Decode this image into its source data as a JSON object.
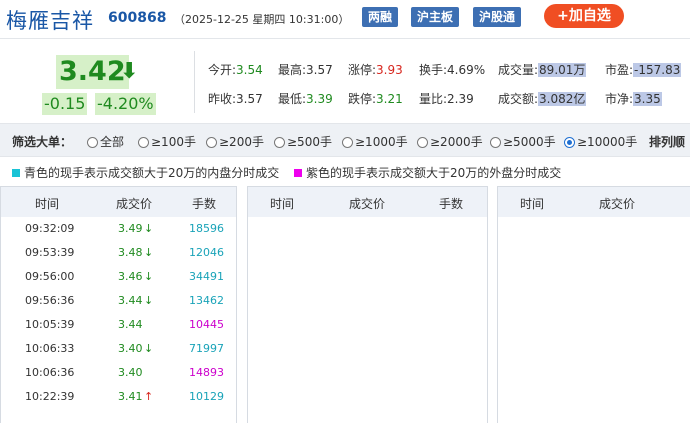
{
  "header": {
    "name": "梅雁吉祥",
    "code": "600868",
    "datetime": "（2025-12-25 星期四 10:31:00）",
    "tags": [
      "两融",
      "沪主板",
      "沪股通"
    ],
    "add_button": "+加自选"
  },
  "quote": {
    "price": "3.42",
    "price_arrow": "⬇",
    "change": "-0.15",
    "change_pct": "-4.20%",
    "stats": {
      "open_label": "今开:",
      "open": "3.54",
      "high_label": "最高:",
      "high": "3.57",
      "limit_up_label": "涨停:",
      "limit_up": "3.93",
      "turnover_label": "换手:",
      "turnover": "4.69%",
      "volume_label": "成交量:",
      "volume": "89.01万",
      "pe_label": "市盈:",
      "pe": "-157.83",
      "prev_close_label": "昨收:",
      "prev_close": "3.57",
      "low_label": "最低:",
      "low": "3.39",
      "limit_down_label": "跌停:",
      "limit_down": "3.21",
      "vol_ratio_label": "量比:",
      "vol_ratio": "2.39",
      "amount_label": "成交额:",
      "amount": "3.082亿",
      "pb_label": "市净:",
      "pb": "3.35"
    }
  },
  "filter": {
    "label": "筛选大单：",
    "options": [
      "全部",
      "≥100手",
      "≥200手",
      "≥500手",
      "≥1000手",
      "≥2000手",
      "≥5000手",
      "≥10000手"
    ],
    "selected_index": 7,
    "sort_label": "排列顺"
  },
  "legend": {
    "cyan_text": "青色的现手表示成交额大于20万的内盘分时成交",
    "cyan_color": "#19c3d6",
    "magenta_text": "紫色的现手表示成交额大于20万的外盘分时成交",
    "magenta_color": "#ee00ee"
  },
  "table": {
    "headers": [
      "时间",
      "成交价",
      "手数"
    ],
    "rows": [
      {
        "time": "09:32:09",
        "price": "3.49",
        "dir": "↓",
        "vol": "18596",
        "side": "cyan"
      },
      {
        "time": "09:53:39",
        "price": "3.48",
        "dir": "↓",
        "vol": "12046",
        "side": "cyan"
      },
      {
        "time": "09:56:00",
        "price": "3.46",
        "dir": "↓",
        "vol": "34491",
        "side": "cyan"
      },
      {
        "time": "09:56:36",
        "price": "3.44",
        "dir": "↓",
        "vol": "13462",
        "side": "cyan"
      },
      {
        "time": "10:05:39",
        "price": "3.44",
        "dir": "",
        "vol": "10445",
        "side": "magenta"
      },
      {
        "time": "10:06:33",
        "price": "3.40",
        "dir": "↓",
        "vol": "71997",
        "side": "cyan"
      },
      {
        "time": "10:06:36",
        "price": "3.40",
        "dir": "",
        "vol": "14893",
        "side": "magenta"
      },
      {
        "time": "10:22:39",
        "price": "3.41",
        "dir": "↑",
        "vol": "10129",
        "side": "cyan"
      }
    ]
  }
}
